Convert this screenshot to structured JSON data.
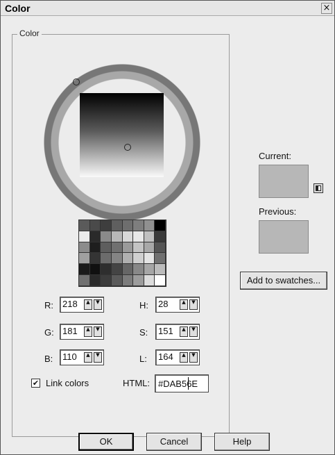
{
  "window": {
    "title": "Color",
    "close_glyph": "×"
  },
  "group": {
    "label": "Color"
  },
  "fields": {
    "r": {
      "label": "R:",
      "value": "218"
    },
    "g": {
      "label": "G:",
      "value": "181"
    },
    "b": {
      "label": "B:",
      "value": "110"
    },
    "h": {
      "label": "H:",
      "value": "28"
    },
    "s": {
      "label": "S:",
      "value": "151"
    },
    "l": {
      "label": "L:",
      "value": "164"
    }
  },
  "link_colors": {
    "label": "Link colors",
    "checked": true,
    "check_glyph": "✔"
  },
  "html": {
    "label": "HTML:",
    "value": "#DAB56E"
  },
  "current": {
    "label": "Current:",
    "color": "#b7b7b7"
  },
  "previous": {
    "label": "Previous:",
    "color": "#b7b7b7"
  },
  "swatches_button": {
    "label": "Add to swatches..."
  },
  "buttons": {
    "ok": "OK",
    "cancel": "Cancel",
    "help": "Help"
  },
  "spin_glyphs": {
    "up": "▲",
    "down": "▼"
  },
  "swatch_grid": {
    "rows": 6,
    "cols": 8,
    "colors": [
      "#5a5a5a",
      "#4a4a4a",
      "#3e3e3e",
      "#5f5f5f",
      "#6e6e6e",
      "#7e7e7e",
      "#909090",
      "#000000",
      "#ebebeb",
      "#2a2a2a",
      "#8a8a8a",
      "#b8b8b8",
      "#d8d8d8",
      "#e8e8e8",
      "#c0c0c0",
      "#3a3a3a",
      "#8c8c8c",
      "#1e1e1e",
      "#5e5e5e",
      "#707070",
      "#9a9a9a",
      "#c4c4c4",
      "#a8a8a8",
      "#555555",
      "#a0a0a0",
      "#343434",
      "#6c6c6c",
      "#848484",
      "#b0b0b0",
      "#d0d0d0",
      "#e4e4e4",
      "#707070",
      "#1a1a1a",
      "#101010",
      "#2e2e2e",
      "#444444",
      "#666666",
      "#888888",
      "#a6a6a6",
      "#bcbcbc",
      "#707070",
      "#2a2a2a",
      "#3c3c3c",
      "#5a5a5a",
      "#7c7c7c",
      "#9c9c9c",
      "#dcdcdc",
      "#ffffff"
    ]
  }
}
